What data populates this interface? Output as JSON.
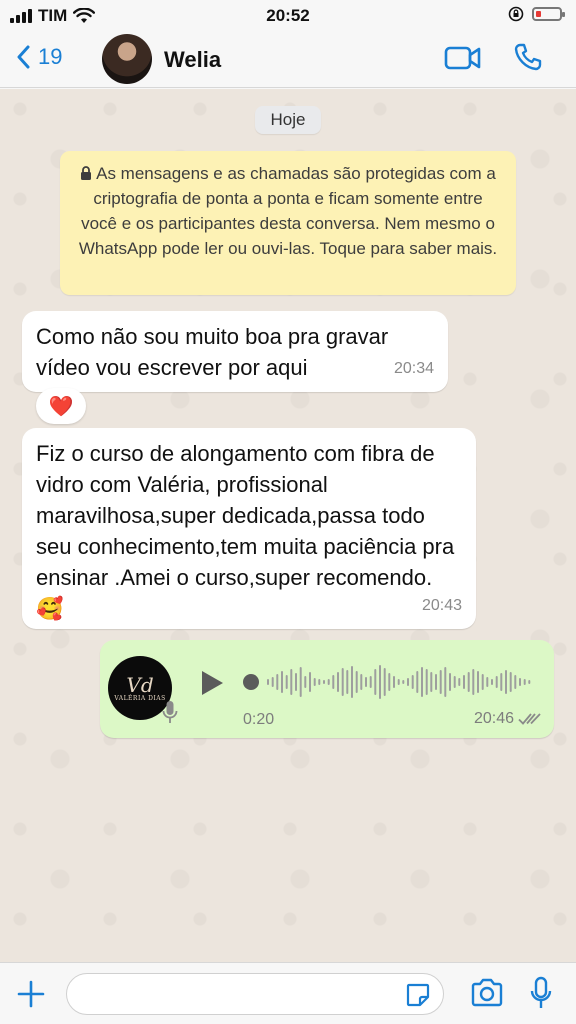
{
  "status_bar": {
    "carrier": "TIM",
    "time": "20:52"
  },
  "header": {
    "back_count": "19",
    "contact_name": "Welia"
  },
  "chat": {
    "date_chip": "Hoje",
    "encryption_notice": "As mensagens e as chamadas são protegidas com a criptografia de ponta a ponta e ficam somente entre você e os participantes desta conversa. Nem mesmo o WhatsApp pode ler ou ouvi-las. Toque para saber mais.",
    "messages": [
      {
        "text": "Como não sou muito boa pra gravar vídeo vou escrever por aqui",
        "time": "20:34",
        "reaction": "❤️"
      },
      {
        "text": "Fiz o curso de alongamento com fibra de vidro  com Valéria, profissional maravilhosa,super  dedicada,passa todo seu  conhecimento,tem muita paciência pra ensinar .Amei o curso,super recomendo. 🥰",
        "time": "20:43"
      }
    ],
    "audio": {
      "avatar_monogram": "Vd",
      "avatar_brand": "VALÉRIA DIAS",
      "duration": "0:20",
      "time": "20:46",
      "progress": 0
    }
  },
  "bottom_bar": {
    "input_value": ""
  },
  "icons": {
    "back": "chevron-left-icon",
    "video": "video-camera-icon",
    "call": "phone-icon",
    "lock": "lock-icon",
    "play": "play-icon",
    "mic": "microphone-icon",
    "ticks": "double-check-icon",
    "plus": "plus-icon",
    "sticker": "sticker-icon",
    "camera": "camera-icon"
  },
  "colors": {
    "accent": "#1a7fd4",
    "outgoing_bubble": "#dcf8c6",
    "notice_bg": "#fdf2b5",
    "battery_low": "#e53935"
  }
}
